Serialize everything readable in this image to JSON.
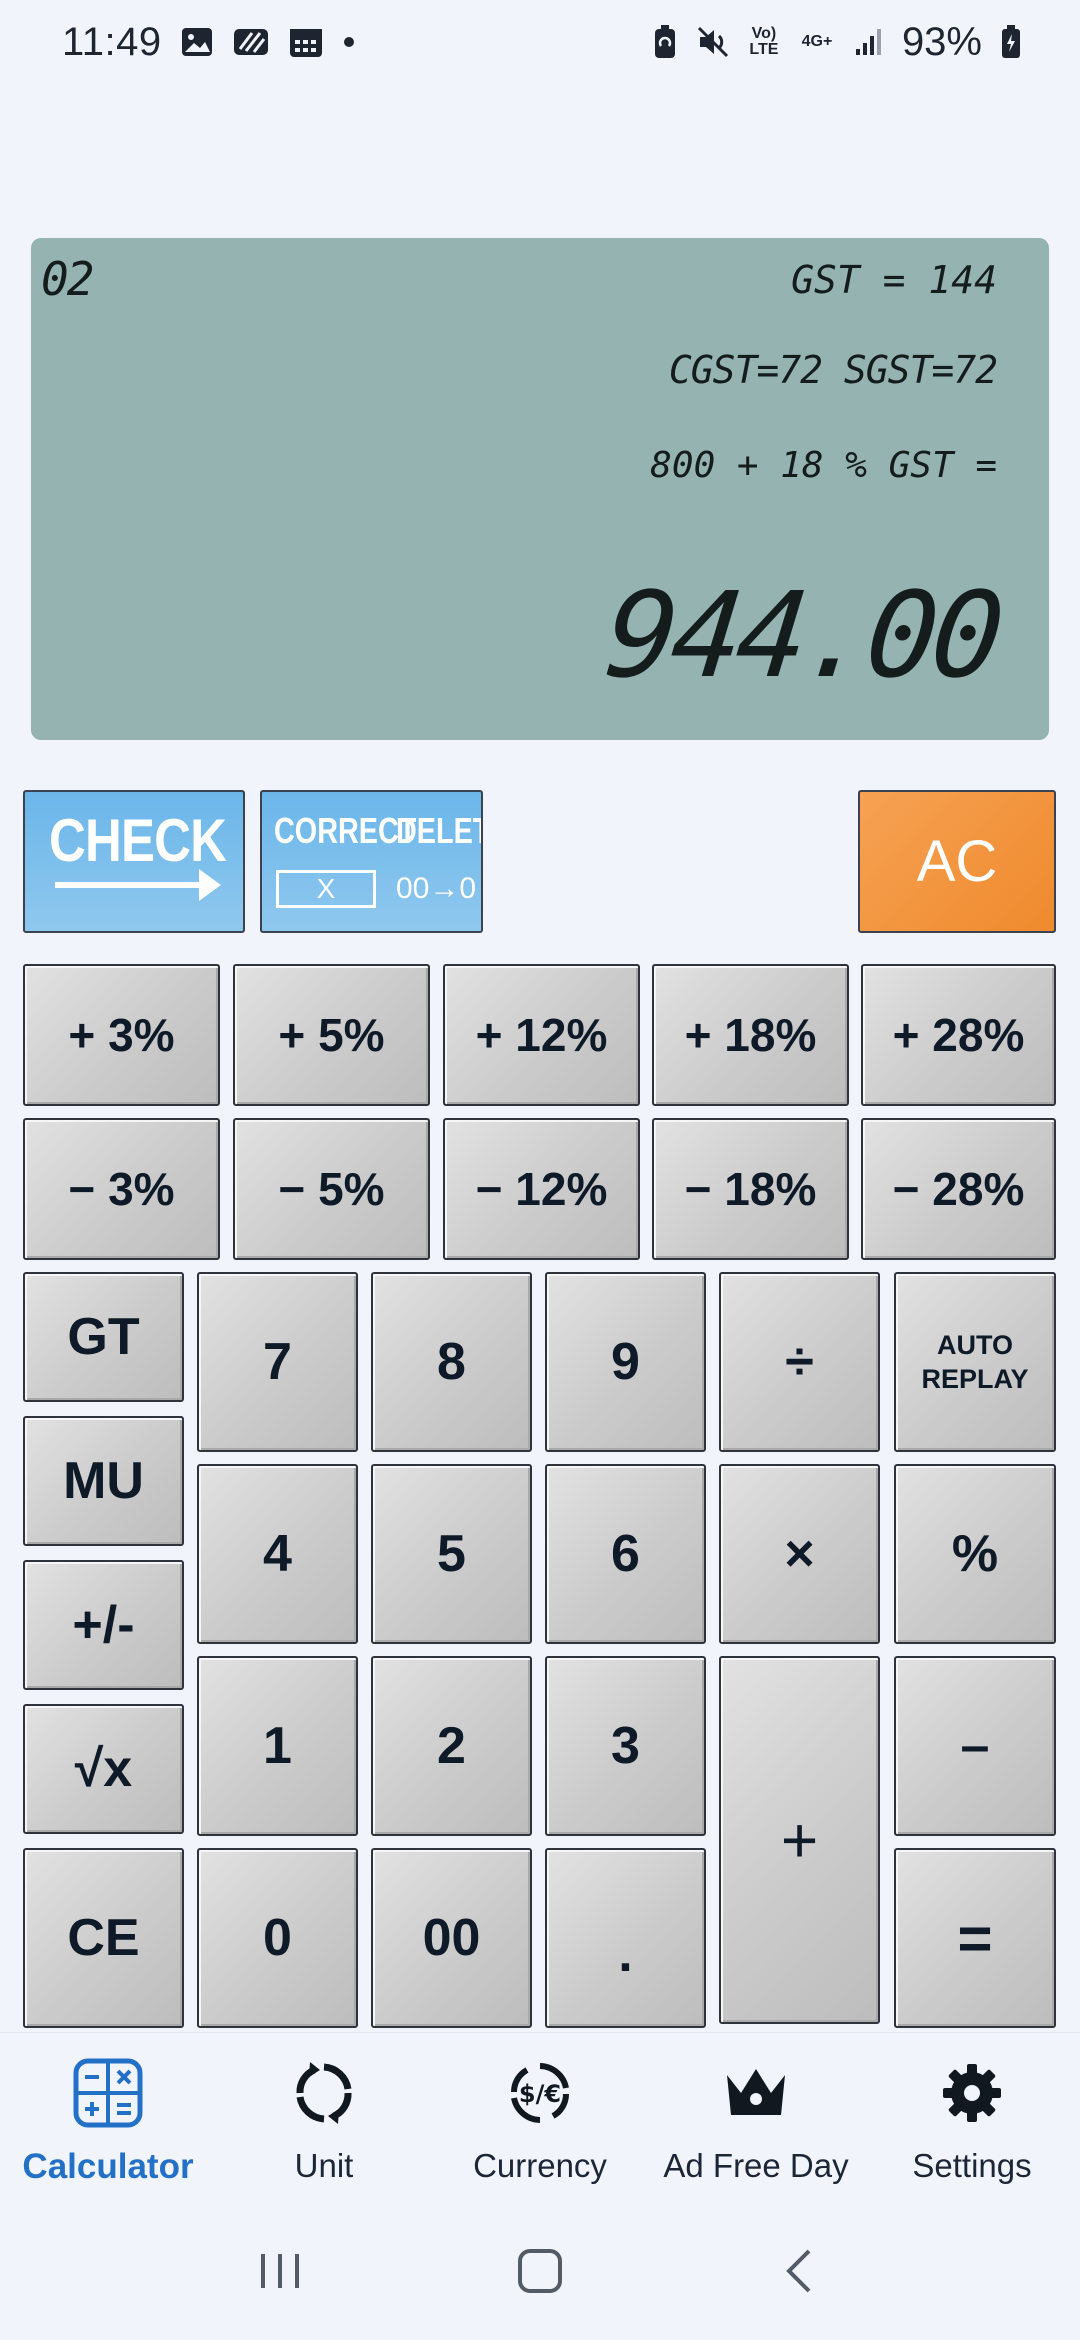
{
  "status_bar": {
    "time": "11:49",
    "battery": "93%",
    "network": "4G+",
    "volte": "Vo) LTE"
  },
  "display": {
    "counter": "02",
    "gst_line": "GST = 144",
    "split_line": "CGST=72 SGST=72",
    "expression": "800 + 18 % GST =",
    "result": "944.00"
  },
  "special_buttons": {
    "check": "CHECK",
    "correct": "CORRECT",
    "correct_box": "X",
    "delete": "DELETE",
    "delete_sub": "00→0",
    "ac": "AC"
  },
  "keys": {
    "plus_3": "+ 3%",
    "plus_5": "+ 5%",
    "plus_12": "+ 12%",
    "plus_18": "+ 18%",
    "plus_28": "+ 28%",
    "minus_3": "− 3%",
    "minus_5": "− 5%",
    "minus_12": "− 12%",
    "minus_18": "− 18%",
    "minus_28": "− 28%",
    "gt": "GT",
    "mu": "MU",
    "plus_minus": "+/-",
    "sqrt": "√x",
    "ce": "CE",
    "seven": "7",
    "eight": "8",
    "nine": "9",
    "divide": "÷",
    "auto_replay_1": "AUTO",
    "auto_replay_2": "REPLAY",
    "four": "4",
    "five": "5",
    "six": "6",
    "multiply": "×",
    "percent": "%",
    "one": "1",
    "two": "2",
    "three": "3",
    "plus": "+",
    "minus": "–",
    "zero": "0",
    "double_zero": "00",
    "dot": ".",
    "equals": "="
  },
  "bottom_nav": {
    "items": [
      {
        "label": "Calculator",
        "icon": "calculator-icon",
        "active": true
      },
      {
        "label": "Unit",
        "icon": "unit-convert-icon",
        "active": false
      },
      {
        "label": "Currency",
        "icon": "currency-exchange-icon",
        "active": false
      },
      {
        "label": "Ad Free Day",
        "icon": "crown-icon",
        "active": false
      },
      {
        "label": "Settings",
        "icon": "gear-icon",
        "active": false
      }
    ]
  },
  "colors": {
    "display_bg": "#94b3b1",
    "check_blue": "#7cbdea",
    "ac_orange": "#f1923a",
    "active_nav": "#2370c7"
  }
}
